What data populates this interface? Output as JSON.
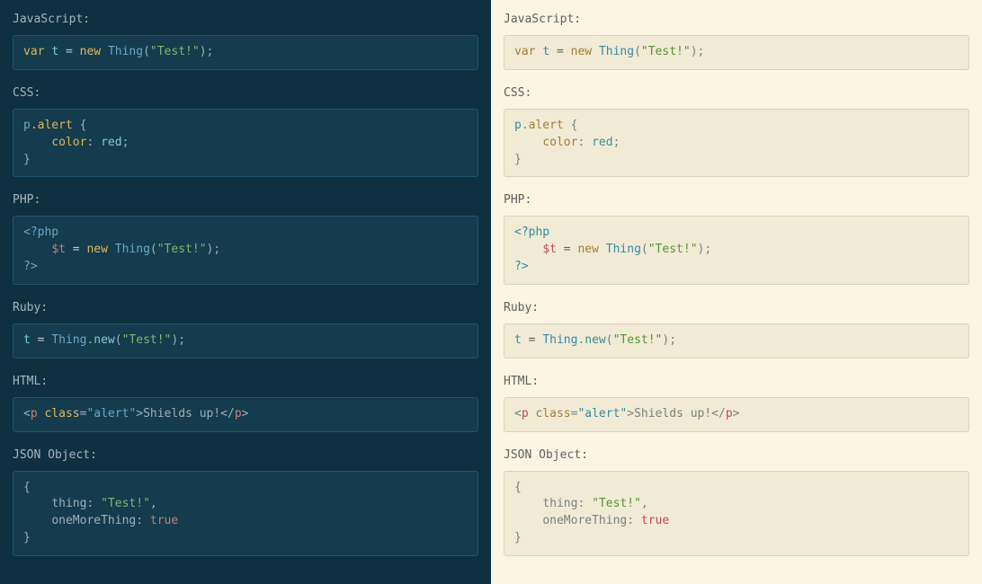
{
  "labels": {
    "javascript": "JavaScript:",
    "css": "CSS:",
    "php": "PHP:",
    "ruby": "Ruby:",
    "html": "HTML:",
    "json": "JSON Object:"
  },
  "t": {
    "var": "var",
    "tvar": "t",
    "eq": " = ",
    "new": "new",
    "sp": " ",
    "thing": "Thing",
    "lp": "(",
    "teststr": "\"Test!\"",
    "rp": ")",
    "semi": ";",
    "palert": "p",
    "dotalert": ".alert",
    "brace_sp": " {",
    "indent": "    ",
    "colorprop": "color",
    "colon_sp": ": ",
    "red": "red",
    "rbrace": "}",
    "phpopen": "<?php",
    "phpvar": "$t",
    "phpclose": "?>",
    "dot": ".",
    "newmethod": "new",
    "lt": "<",
    "ptag": "p",
    "classattr": "class",
    "eqsign": "=",
    "alertstr": "\"alert\"",
    "gt": ">",
    "shields": "Shields up!",
    "ltslash": "</",
    "lbrace": "{",
    "thingprop": "thing",
    "onemore": "oneMoreThing",
    "true": "true",
    "comma": ",",
    "plain_semi": ";"
  }
}
